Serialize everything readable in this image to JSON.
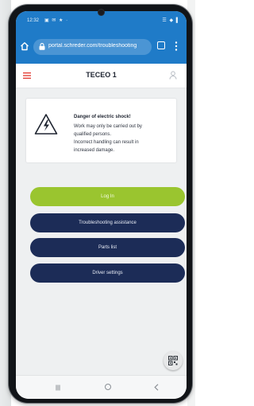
{
  "statusbar": {
    "time": "12:32",
    "icons_left": "▣ ✉ ★ ·",
    "icons_right": "☰ ◆ ▌"
  },
  "browser": {
    "url": "portal.schreder.com/troubleshooting",
    "tab_count": ""
  },
  "app": {
    "title": "TECEO 1"
  },
  "warning": {
    "title": "Danger of electric shock!",
    "lines": [
      "Work may only be carried out by",
      "qualified persons.",
      "Incorrect handling can result in",
      "increased damage."
    ]
  },
  "buttons": {
    "login": "Log In",
    "troubleshooting": "Troubleshooting assistance",
    "parts_list": "Parts list",
    "driver_settings": "Driver settings"
  },
  "colors": {
    "browser_bar": "#1f7bc8",
    "login_button": "#9ac52f",
    "nav_button": "#1c2c57",
    "hamburger": "#e2342b"
  },
  "icons": {
    "home": "home-icon",
    "lock": "lock-icon",
    "menu": "menu-icon",
    "hamburger": "hamburger-icon",
    "user": "user-icon",
    "warning": "electric-warning-icon",
    "qr": "qr-code-icon"
  }
}
